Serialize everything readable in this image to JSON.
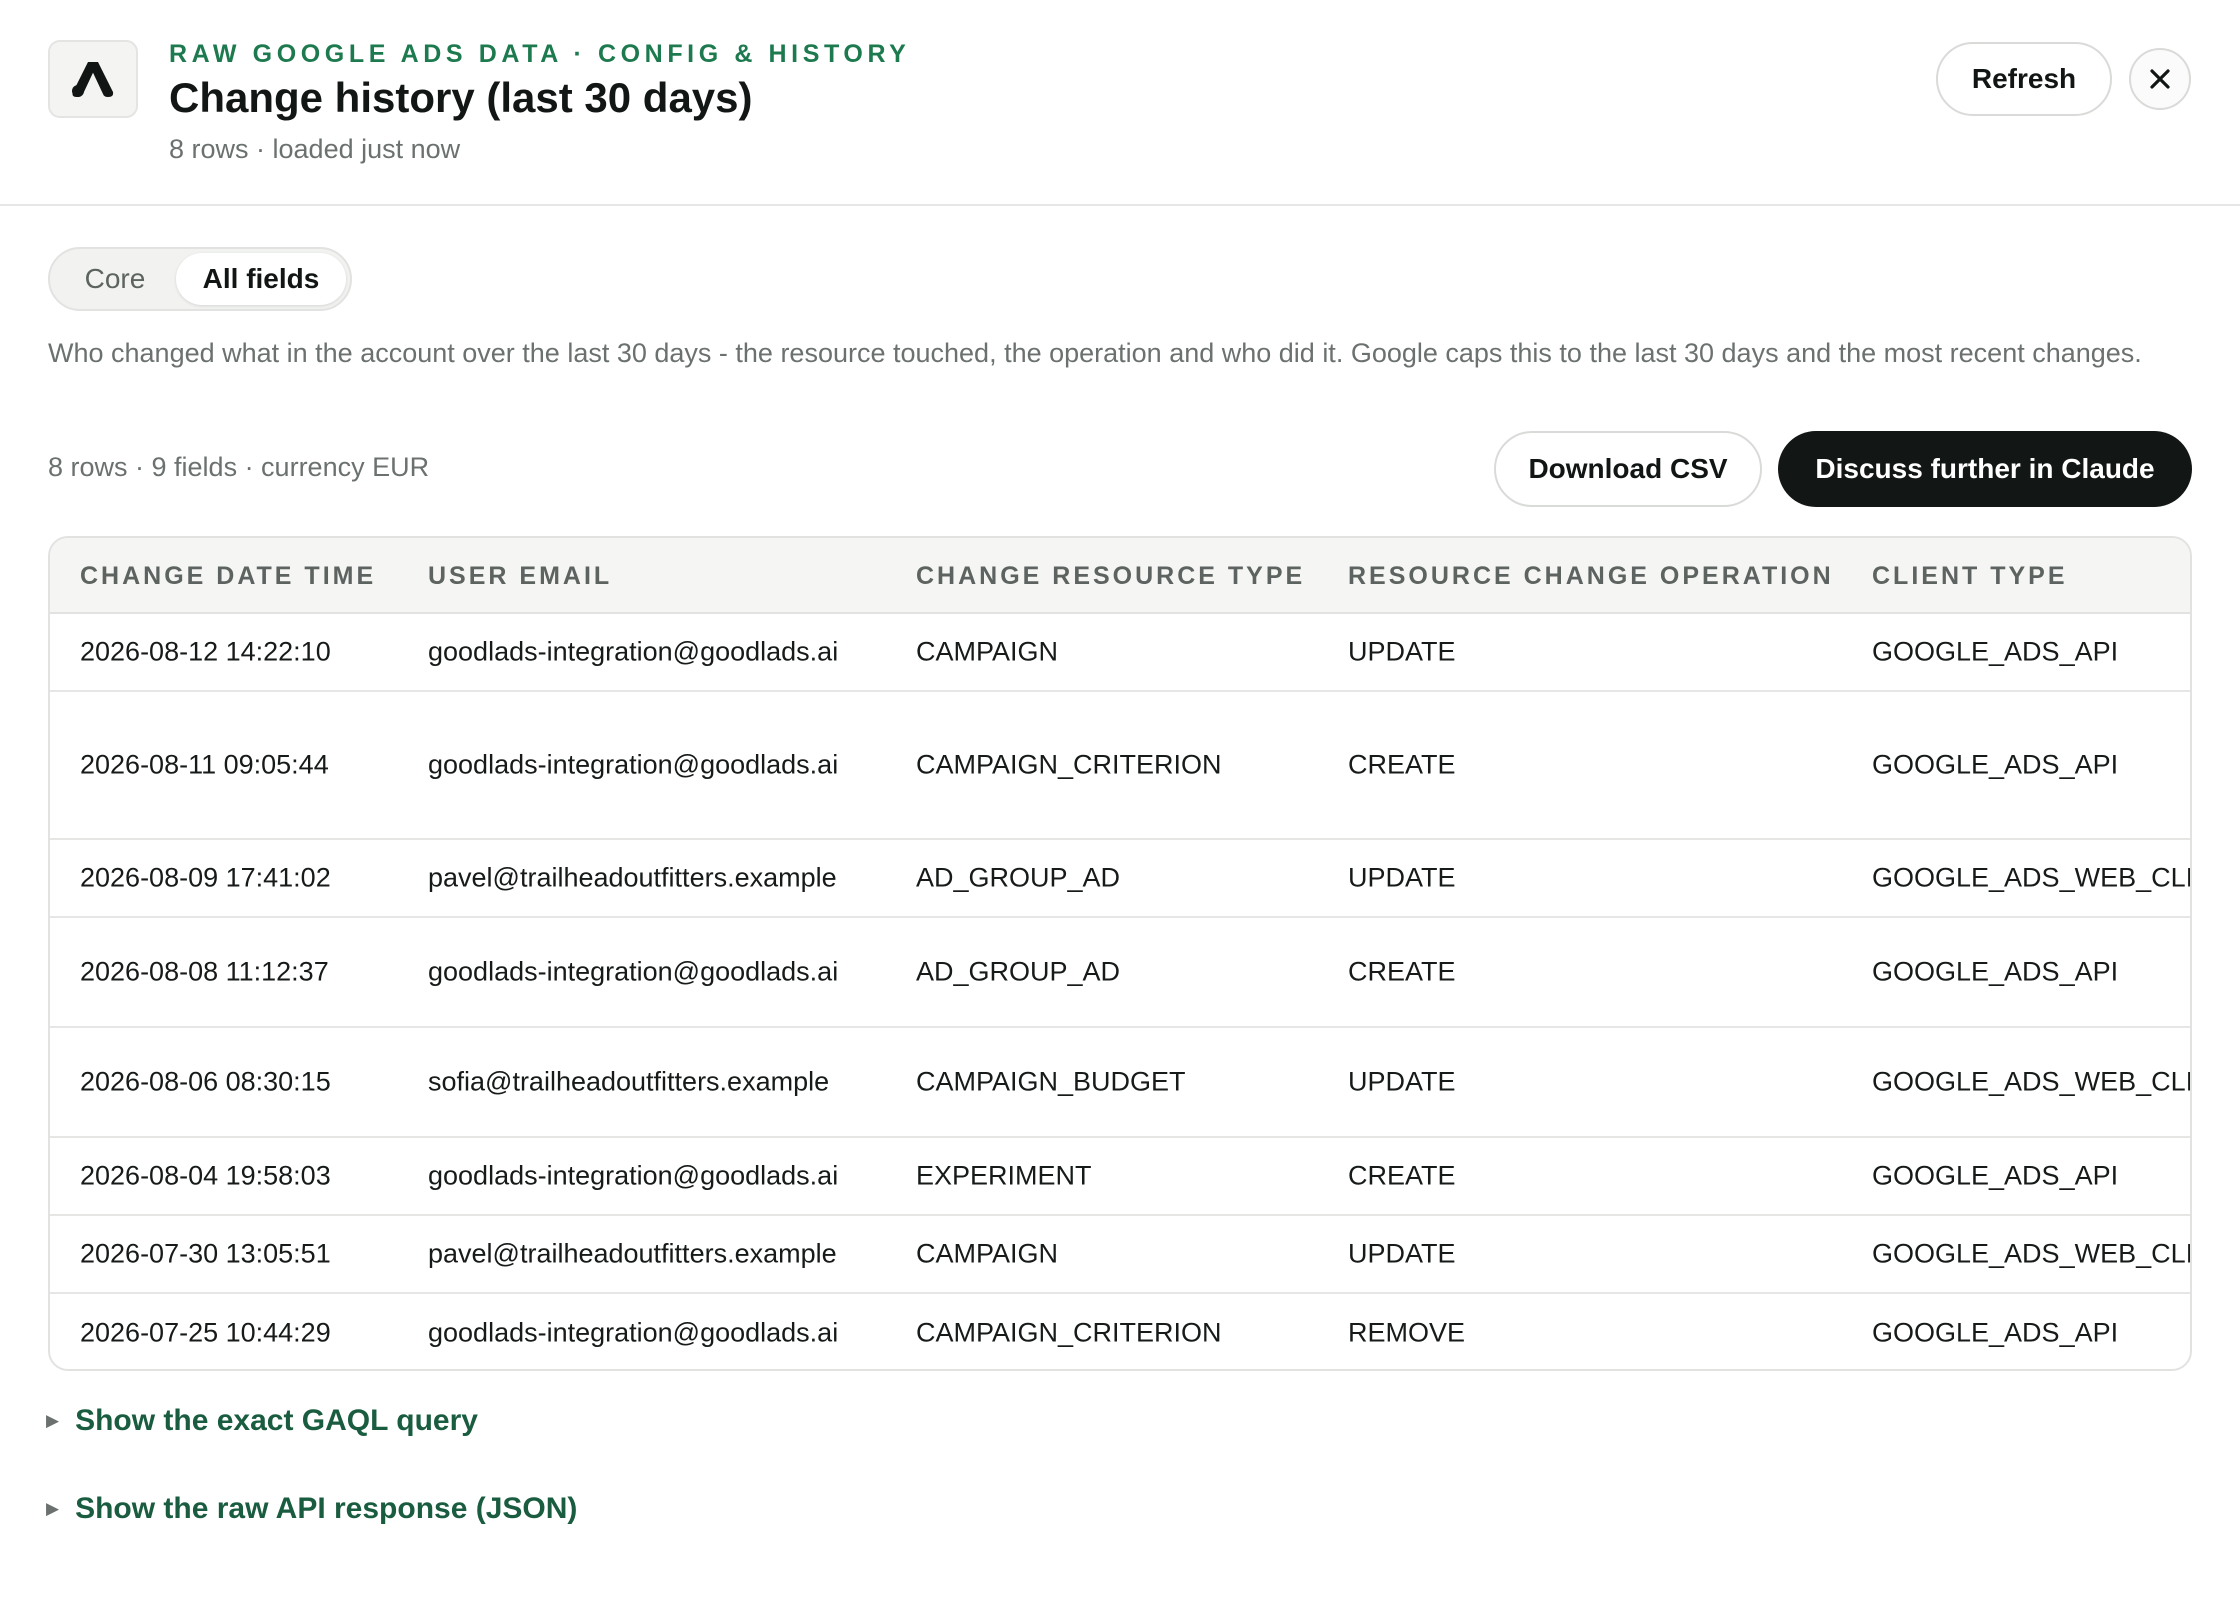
{
  "header": {
    "eyebrow": "RAW GOOGLE ADS DATA · CONFIG & HISTORY",
    "title": "Change history (last 30 days)",
    "meta": "8 rows · loaded just now",
    "refresh_label": "Refresh",
    "logo_icon": "google-ads-logo",
    "close_icon": "close-icon"
  },
  "tabs": {
    "core": "Core",
    "all_fields": "All fields",
    "selected": "All fields"
  },
  "description": "Who changed what in the account over the last 30 days - the resource touched, the operation and who did it. Google caps this to the last 30 days and the most recent changes.",
  "summary": "8 rows · 9 fields · currency EUR",
  "actions": {
    "download_csv": "Download CSV",
    "discuss": "Discuss further in Claude"
  },
  "table": {
    "columns": [
      "CHANGE DATE TIME",
      "USER EMAIL",
      "CHANGE RESOURCE TYPE",
      "RESOURCE CHANGE OPERATION",
      "CLIENT TYPE"
    ],
    "rows": [
      [
        "2026-08-12 14:22:10",
        "goodlads-integration@goodlads.ai",
        "CAMPAIGN",
        "UPDATE",
        "GOOGLE_ADS_API"
      ],
      [
        "2026-08-11 09:05:44",
        "goodlads-integration@goodlads.ai",
        "CAMPAIGN_CRITERION",
        "CREATE",
        "GOOGLE_ADS_API"
      ],
      [
        "2026-08-09 17:41:02",
        "pavel@trailheadoutfitters.example",
        "AD_GROUP_AD",
        "UPDATE",
        "GOOGLE_ADS_WEB_CLIENT"
      ],
      [
        "2026-08-08 11:12:37",
        "goodlads-integration@goodlads.ai",
        "AD_GROUP_AD",
        "CREATE",
        "GOOGLE_ADS_API"
      ],
      [
        "2026-08-06 08:30:15",
        "sofia@trailheadoutfitters.example",
        "CAMPAIGN_BUDGET",
        "UPDATE",
        "GOOGLE_ADS_WEB_CLIENT"
      ],
      [
        "2026-08-04 19:58:03",
        "goodlads-integration@goodlads.ai",
        "EXPERIMENT",
        "CREATE",
        "GOOGLE_ADS_API"
      ],
      [
        "2026-07-30 13:05:51",
        "pavel@trailheadoutfitters.example",
        "CAMPAIGN",
        "UPDATE",
        "GOOGLE_ADS_WEB_CLIENT"
      ],
      [
        "2026-07-25 10:44:29",
        "goodlads-integration@goodlads.ai",
        "CAMPAIGN_CRITERION",
        "REMOVE",
        "GOOGLE_ADS_API"
      ]
    ]
  },
  "disclosures": {
    "gaql": "Show the exact GAQL query",
    "raw_json": "Show the raw API response (JSON)"
  },
  "colors": {
    "accent": "#1d7a4f",
    "link": "#1a5c40",
    "dark_button": "#121716"
  }
}
